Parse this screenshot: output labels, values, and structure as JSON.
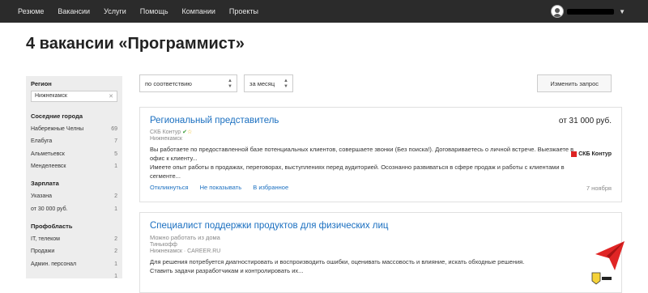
{
  "nav": {
    "items": [
      "Резюме",
      "Вакансии",
      "Услуги",
      "Помощь",
      "Компании",
      "Проекты"
    ]
  },
  "page": {
    "title": "4 вакансии «Программист»"
  },
  "sidebar": {
    "region_title": "Регион",
    "region_value": "Нижнекамск",
    "cities_title": "Соседние города",
    "cities": [
      {
        "name": "Набережные Челны",
        "count": "69"
      },
      {
        "name": "Елабуга",
        "count": "7"
      },
      {
        "name": "Альметьевск",
        "count": "5"
      },
      {
        "name": "Менделеевск",
        "count": "1"
      }
    ],
    "salary_title": "Зарплата",
    "salary": [
      {
        "name": "Указана",
        "count": "2"
      },
      {
        "name": "от 30 000 руб.",
        "count": "1"
      }
    ],
    "prof_title": "Профобласть",
    "prof": [
      {
        "name": "IT, телеком",
        "count": "2"
      },
      {
        "name": "Продажи",
        "count": "2"
      },
      {
        "name": "Админ. персонал",
        "count": "1"
      },
      {
        "name": "",
        "count": "1"
      }
    ]
  },
  "controls": {
    "sort_label": "по соответствию",
    "period_label": "за месяц",
    "edit_button": "Изменить запрос"
  },
  "vacancies": [
    {
      "title": "Региональный представитель",
      "salary": "от 31 000 руб.",
      "company": "СКБ Контур",
      "city": "Нижнекамск",
      "desc1": "Вы работаете по предоставленной базе потенциальных клиентов, совершаете звонки (Без поиска!). Договариваетесь о личной встрече. Выезжаете в офис к клиенту...",
      "desc2": "Имеете опыт работы в продажах, переговорах, выступлениях перед аудиторией. Осознанно развиваться в сфере продаж и работы с клиентами в сегменте...",
      "respond": "Откликнуться",
      "hide": "Не показывать",
      "favorite": "В избранное",
      "date": "7 ноября",
      "logo_text": "СКБ Контур"
    },
    {
      "title": "Специалист поддержки продуктов для физических лиц",
      "note": "Можно работать из дома",
      "company": "Тинькофф",
      "city": "Нижнекамск · CAREER.RU",
      "desc1": "Для решения потребуется диагностировать и воспроизводить ошибки, оценивать массовость и влияние, искать обходные решения.",
      "desc2": "Ставить задачи разработчикам и контролировать их..."
    }
  ],
  "colors": {
    "topbar": "#2b2b2b",
    "link": "#1a6fc0",
    "sidebar_bg": "#ededed",
    "fab": "#e02525"
  }
}
